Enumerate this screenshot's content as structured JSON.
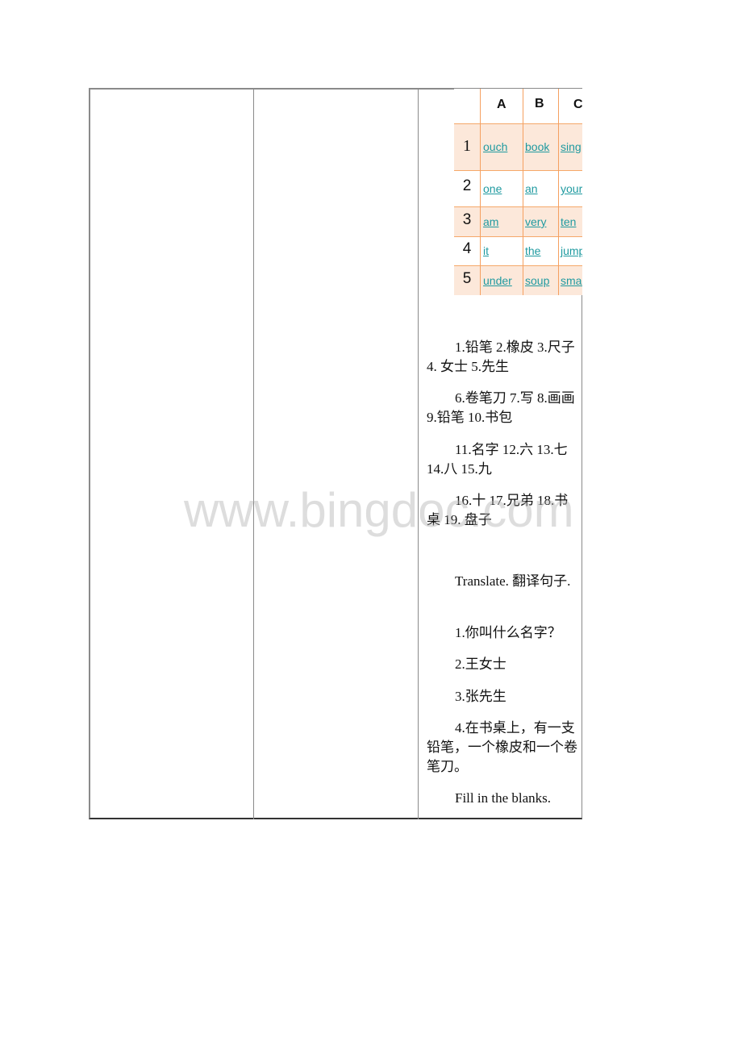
{
  "grid": {
    "column_headers": [
      "A",
      "B",
      "C"
    ],
    "rows": [
      {
        "number": "1",
        "words": [
          "ouch",
          "book",
          "sing"
        ]
      },
      {
        "number": "2",
        "words": [
          "one",
          "an",
          "your"
        ]
      },
      {
        "number": "3",
        "words": [
          "am",
          "very",
          "ten"
        ]
      },
      {
        "number": "4",
        "words": [
          "it",
          "the",
          "jump"
        ]
      },
      {
        "number": "5",
        "words": [
          "under",
          "soup",
          "small"
        ]
      }
    ],
    "colors": {
      "shade": "#fce8da",
      "line": "#f5a060",
      "link": "#1f9aa0"
    }
  },
  "vocab": [
    "1.铅笔 2.橡皮 3.尺子 4. 女士 5.先生",
    "6.卷笔刀 7.写 8.画画 9.铅笔 10.书包",
    "11.名字 12.六 13.七 14.八 15.九",
    "16.十 17.兄弟 18.书桌 19. 盘子"
  ],
  "translate": {
    "heading": "Translate. 翻译句子.",
    "items": [
      "1.你叫什么名字？",
      "2.王女士",
      "3.张先生",
      "4.在书桌上，有一支铅笔，一个橡皮和一个卷笔刀。"
    ]
  },
  "fill_heading": "Fill in the blanks.",
  "watermark": "www.bingdoc.com"
}
